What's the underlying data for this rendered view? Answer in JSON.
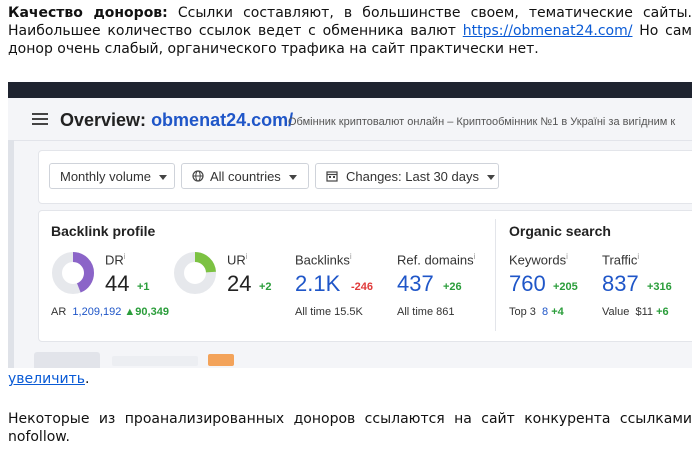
{
  "para1": {
    "bold": "Качество доноров:",
    "text1": " Ссылки составляют, в большинстве своем, тематические сайты. Наибольшее количество ссылок ведет с обменника валют ",
    "link": "https://obmenat24.com/",
    "text2": " Но сам донор очень слабый, органического трафика на сайт практически нет."
  },
  "screenshot": {
    "header_title": "Overview:",
    "header_domain": "obmenat24.com/",
    "header_subtitle": "Обмінник криптовалют онлайн – Криптообмінник №1 в Україні за вигідним к",
    "filters": {
      "volume": "Monthly volume",
      "countries": "All countries",
      "changes": "Changes: Last 30 days"
    },
    "backlink_profile": {
      "title": "Backlink profile",
      "dr": {
        "label": "DR",
        "value": "44",
        "delta": "+1",
        "fraction": 0.44
      },
      "ar": {
        "label": "AR",
        "value": "1,209,192",
        "delta": "▲90,349"
      },
      "ur": {
        "label": "UR",
        "value": "24",
        "delta": "+2",
        "fraction": 0.24
      },
      "backlinks": {
        "label": "Backlinks",
        "value": "2.1K",
        "delta": "-246",
        "sub": "All time 15.5K"
      },
      "ref_domains": {
        "label": "Ref. domains",
        "value": "437",
        "delta": "+26",
        "sub": "All time 861"
      }
    },
    "organic_search": {
      "title": "Organic search",
      "keywords": {
        "label": "Keywords",
        "value": "760",
        "delta": "+205",
        "sub_label": "Top 3",
        "sub_value": "8",
        "sub_delta": "+4"
      },
      "traffic": {
        "label": "Traffic",
        "value": "837",
        "delta": "+316",
        "sub_label": "Value",
        "sub_value": "$11",
        "sub_delta": "+6"
      }
    },
    "info_mark": "i",
    "colors": {
      "dr": "#8b64c8",
      "ur": "#7cc242",
      "ring_bg": "#e6e8ec",
      "accent": "#1f56c8"
    }
  },
  "link_enlarge": "увеличить",
  "link_enlarge_tail": ".",
  "para2": "Некоторые из проанализированных доноров ссылаются на сайт конкурента ссылками nofollow."
}
